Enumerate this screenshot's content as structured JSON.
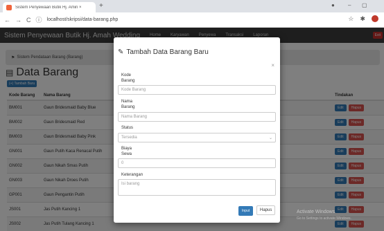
{
  "browser": {
    "tab_title": "Sistem Penyewaan Butik Hj. Amin ×",
    "new_tab": "+",
    "url": "localhost/skripsi/data-barang.php",
    "minimize": "–",
    "maximize": "▢"
  },
  "navbar": {
    "brand": "Sistem Penyewaan Butik Hj. Amah Wedding",
    "links": [
      "Home",
      "Karyawan",
      "Penyewa",
      "Transaksi",
      "Laporan"
    ],
    "logout": "Exit"
  },
  "alert_text": "Sistem Pendataan Barang (Barang)",
  "page_title": "Data Barang",
  "tambah_button": "(+) Tambah Baru",
  "table": {
    "headers": [
      "Kode Barang",
      "Nama Barang",
      "Tindakan"
    ],
    "rows": [
      {
        "kode": "BM001",
        "nama": "Gaun Bridesmaid Baby Blue"
      },
      {
        "kode": "BM002",
        "nama": "Gaun Bridesmaid Red"
      },
      {
        "kode": "BM003",
        "nama": "Gaun Bridesmaid Baby Pink"
      },
      {
        "kode": "GN001",
        "nama": "Gaun Putih Kaca Renacal Putih"
      },
      {
        "kode": "GN002",
        "nama": "Gaun Nikah Smas Putih"
      },
      {
        "kode": "GN003",
        "nama": "Gaun Nikah Droes Putih"
      },
      {
        "kode": "GP001",
        "nama": "Gaun Pengantin Putih"
      },
      {
        "kode": "JS001",
        "nama": "Jas Putih Kancing 1"
      },
      {
        "kode": "JS002",
        "nama": "Jas Putih Tulang Kancing 1"
      }
    ],
    "edit_label": "Edit",
    "hapus_label": "Hapus"
  },
  "modal": {
    "title": "Tambah Data Barang Baru",
    "close": "×",
    "kode_label_1": "Kode",
    "kode_label_2": "Barang",
    "kode_placeholder": "Kode Barang",
    "nama_label_1": "Nama",
    "nama_label_2": "Barang",
    "nama_placeholder": "Nama Barang",
    "status_label": "Status",
    "status_value": "Tersedia",
    "biaya_label_1": "Biaya",
    "biaya_label_2": "Sewa",
    "biaya_value": "0",
    "keterangan_label": "Keterangan",
    "keterangan_placeholder": "Isi barang",
    "input_button": "Input",
    "hapus_button": "Hapus"
  },
  "watermark": {
    "line1": "Activate Windows",
    "line2": "Go to Settings to activate Windows."
  }
}
